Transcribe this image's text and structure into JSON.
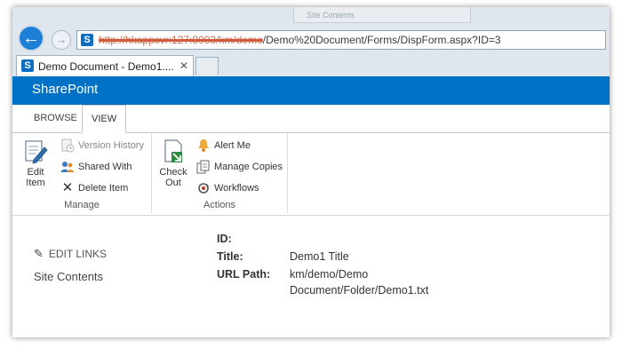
{
  "browser": {
    "url_redacted": "http://hkappsvr:127:8003/km/demo",
    "url_visible": "/Demo%20Document/Forms/DispForm.aspx?ID=3",
    "background_tab_title": "Site Contents",
    "tab_title": "Demo Document - Demo1....",
    "tab_close": "✕"
  },
  "suitebar": {
    "brand": "SharePoint"
  },
  "ribbon_tabs": {
    "browse": "BROWSE",
    "view": "VIEW"
  },
  "ribbon": {
    "manage": {
      "label": "Manage",
      "edit_item": "Edit Item",
      "version_history": "Version History",
      "shared_with": "Shared With",
      "delete_item": "Delete Item"
    },
    "actions": {
      "label": "Actions",
      "check_out": "Check Out",
      "alert_me": "Alert Me",
      "manage_copies": "Manage Copies",
      "workflows": "Workflows"
    }
  },
  "leftnav": {
    "edit_links": "EDIT LINKS",
    "site_contents": "Site Contents"
  },
  "properties": {
    "id_label": "ID:",
    "id_value": "",
    "title_label": "Title:",
    "title_value": "Demo1 Title",
    "url_label": "URL Path:",
    "url_value_line1": "km/demo/Demo",
    "url_value_line2": "Document/Folder/Demo1.txt"
  },
  "colors": {
    "sharepoint_blue": "#0072c6",
    "browser_back": "#1e7fd6"
  }
}
